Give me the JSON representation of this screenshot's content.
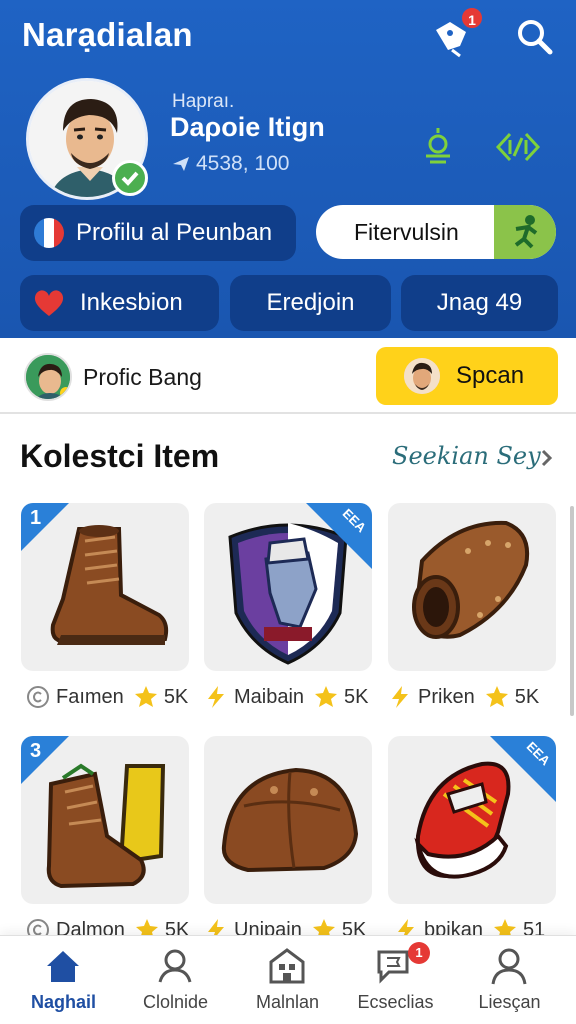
{
  "app": {
    "title": "Narạdialan",
    "notification_count": "1"
  },
  "profile": {
    "small_label": "Hapraı.",
    "name": "Daροie Itign",
    "stat": "4538, 100"
  },
  "buttons": {
    "profile_pill": "Profilu al Peunban",
    "filter_pill": "Fitervulsin",
    "inkesbion": "Inkesbion",
    "eredjoin": "Eredjoin",
    "jnag": "Jnag 49"
  },
  "profile_bar": {
    "label": "Profic Bang",
    "action": "Spcan"
  },
  "section": {
    "title": "Kolestci Item",
    "see_all": "Seekian Sey"
  },
  "items": [
    {
      "name": "Faımen",
      "rating": "5K",
      "badge": "1"
    },
    {
      "name": "Maibain",
      "rating": "5K",
      "badge": "EEA"
    },
    {
      "name": "Priken",
      "rating": "5K",
      "badge": ""
    },
    {
      "name": "Dalmon",
      "rating": "5K",
      "badge": "3"
    },
    {
      "name": "Unipain",
      "rating": "5K",
      "badge": ""
    },
    {
      "name": "bpikan",
      "rating": "51",
      "badge": "EEA"
    }
  ],
  "nav": [
    {
      "label": "Naghail",
      "icon": "home-icon",
      "active": true
    },
    {
      "label": "Clolnide",
      "icon": "user-icon"
    },
    {
      "label": "Malnlan",
      "icon": "building-icon"
    },
    {
      "label": "Ecseclias",
      "icon": "chat-flag-icon",
      "badge": "1"
    },
    {
      "label": "Liesçan",
      "icon": "profile-icon"
    }
  ],
  "colors": {
    "header_blue": "#1f63c4",
    "pill_dark": "#103e8a",
    "accent_yellow": "#ffd21a",
    "accent_green": "#8bc34a",
    "badge_red": "#e53935",
    "nav_active": "#1f4fa3"
  }
}
